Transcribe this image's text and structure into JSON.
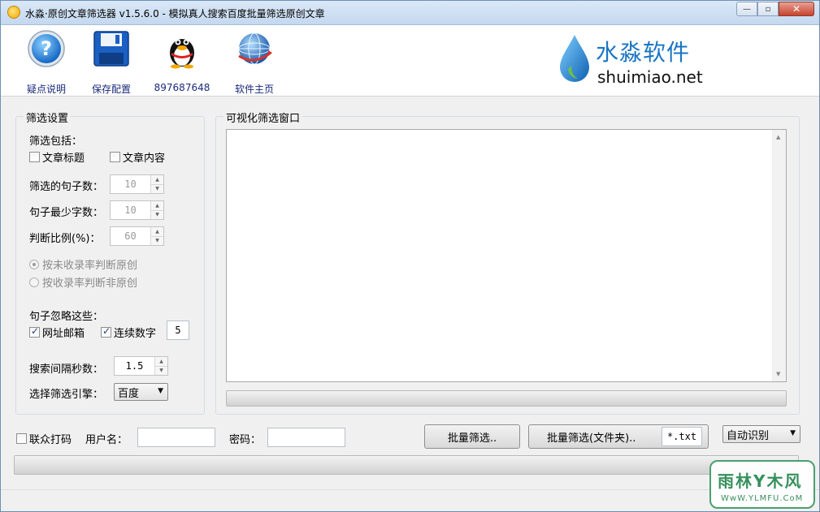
{
  "window": {
    "title": "水淼·原创文章筛选器 v1.5.6.0 - 模拟真人搜索百度批量筛选原创文章",
    "controls": {
      "minimize": "—",
      "maximize": "▫",
      "close": "✕"
    }
  },
  "toolbar": {
    "items": [
      {
        "label": "疑点说明",
        "icon": "help-icon"
      },
      {
        "label": "保存配置",
        "icon": "save-icon"
      },
      {
        "label": "897687648",
        "icon": "qq-icon"
      },
      {
        "label": "软件主页",
        "icon": "globe-icon"
      }
    ],
    "brand": {
      "name": "水淼软件",
      "url": "shuimiao.net"
    }
  },
  "filter_settings": {
    "title": "筛选设置",
    "include_label": "筛选包括：",
    "include_options": [
      {
        "label": "文章标题",
        "checked": false
      },
      {
        "label": "文章内容",
        "checked": false
      }
    ],
    "sentence_count": {
      "label": "筛选的句子数：",
      "value": "10"
    },
    "min_chars": {
      "label": "句子最少字数：",
      "value": "10"
    },
    "ratio": {
      "label": "判断比例(%)：",
      "value": "60"
    },
    "judge_modes": [
      {
        "label": "按未收录率判断原创",
        "selected": true
      },
      {
        "label": "按收录率判断非原创",
        "selected": false
      }
    ],
    "ignore_label": "句子忽略这些：",
    "ignore_options": [
      {
        "label": "网址邮箱",
        "checked": true
      },
      {
        "label": "连续数字",
        "checked": true
      }
    ],
    "digits_value": "5",
    "interval": {
      "label": "搜索间隔秒数：",
      "value": "1.5"
    },
    "engine": {
      "label": "选择筛选引擎：",
      "value": "百度"
    }
  },
  "visual_window": {
    "title": "可视化筛选窗口"
  },
  "bottom": {
    "captcha_label": "联众打码",
    "captcha_checked": false,
    "username_label": "用户名：",
    "username_value": "",
    "password_label": "密码：",
    "password_value": "",
    "batch_button": "批量筛选..",
    "batch_folder_button": "批量筛选(文件夹)..",
    "file_ext": "*.txt",
    "detect_mode": "自动识别"
  },
  "watermark": {
    "line1": "雨林Y木风",
    "line2": "WwW.YLMFU.CoM"
  },
  "colors": {
    "brand_blue": "#1a75c4",
    "watermark_green": "#37905c"
  }
}
